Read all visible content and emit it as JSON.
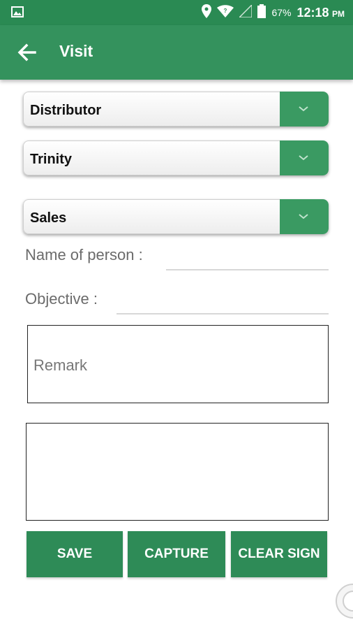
{
  "status_bar": {
    "battery_percent": "67%",
    "time": "12:18",
    "time_suffix": "PM"
  },
  "app_bar": {
    "title": "Visit"
  },
  "dropdowns": [
    {
      "selected": "Distributor"
    },
    {
      "selected": "Trinity"
    },
    {
      "selected": "Sales"
    }
  ],
  "form": {
    "name_label": "Name of person :",
    "objective_label": "Objective :",
    "remark_placeholder": "Remark"
  },
  "buttons": {
    "save": "SAVE",
    "capture": "CAPTURE",
    "clear_sign": "CLEAR SIGN"
  },
  "colors": {
    "status_bar": "#2a8a53",
    "app_bar": "#34925d",
    "accent": "#2e8b57"
  }
}
